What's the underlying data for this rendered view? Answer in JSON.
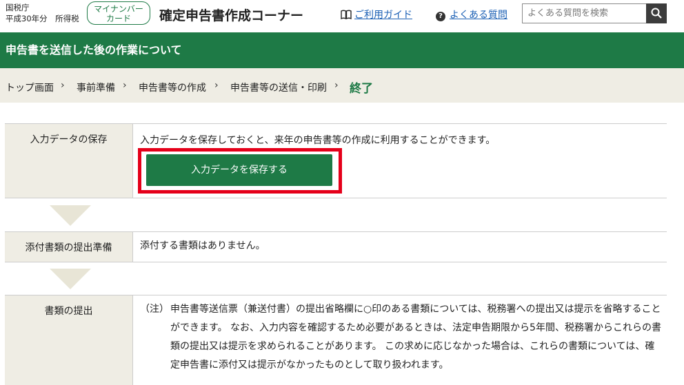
{
  "header": {
    "agency": "国税庁",
    "tax_year": "平成30年分　所得税",
    "mynumber_button": "マイナンバーカード",
    "mynumber_line1": "マイナンバー",
    "mynumber_line2": "カード",
    "app_title": "確定申告書作成コーナー",
    "guide_link": "ご利用ガイド",
    "faq_link": "よくある質問",
    "search_placeholder": "よくある質問を検索",
    "search_button_icon": "search-icon"
  },
  "page_title": "申告書を送信した後の作業について",
  "breadcrumb": {
    "items": [
      "トップ画面",
      "事前準備",
      "申告書等の作成",
      "申告書等の送信・印刷"
    ],
    "separator": "›",
    "current": "終了"
  },
  "sections": [
    {
      "label": "入力データの保存",
      "text": "入力データを保存しておくと、来年の申告書等の作成に利用することができます。",
      "button": "入力データを保存する"
    },
    {
      "label": "添付書類の提出準備",
      "text": "添付する書類はありません。"
    },
    {
      "label": "書類の提出",
      "note_label": "（注）",
      "note_text": "申告書等送信票（兼送付書）の提出省略欄に○印のある書類については、税務署への提出又は提示を省略することができます。 なお、入力内容を確認するため必要があるときは、法定申告期限から5年間、税務署からこれらの書類の提出又は提示を求められることがあります。 この求めに応じなかった場合は、これらの書類については、確定申告書に添付又は提示がなかったものとして取り扱われます。"
    }
  ],
  "colors": {
    "brand_green": "#1e7a46",
    "label_bg": "#efede4",
    "highlight_red": "#e5001a",
    "link_blue": "#1a5fb4"
  }
}
